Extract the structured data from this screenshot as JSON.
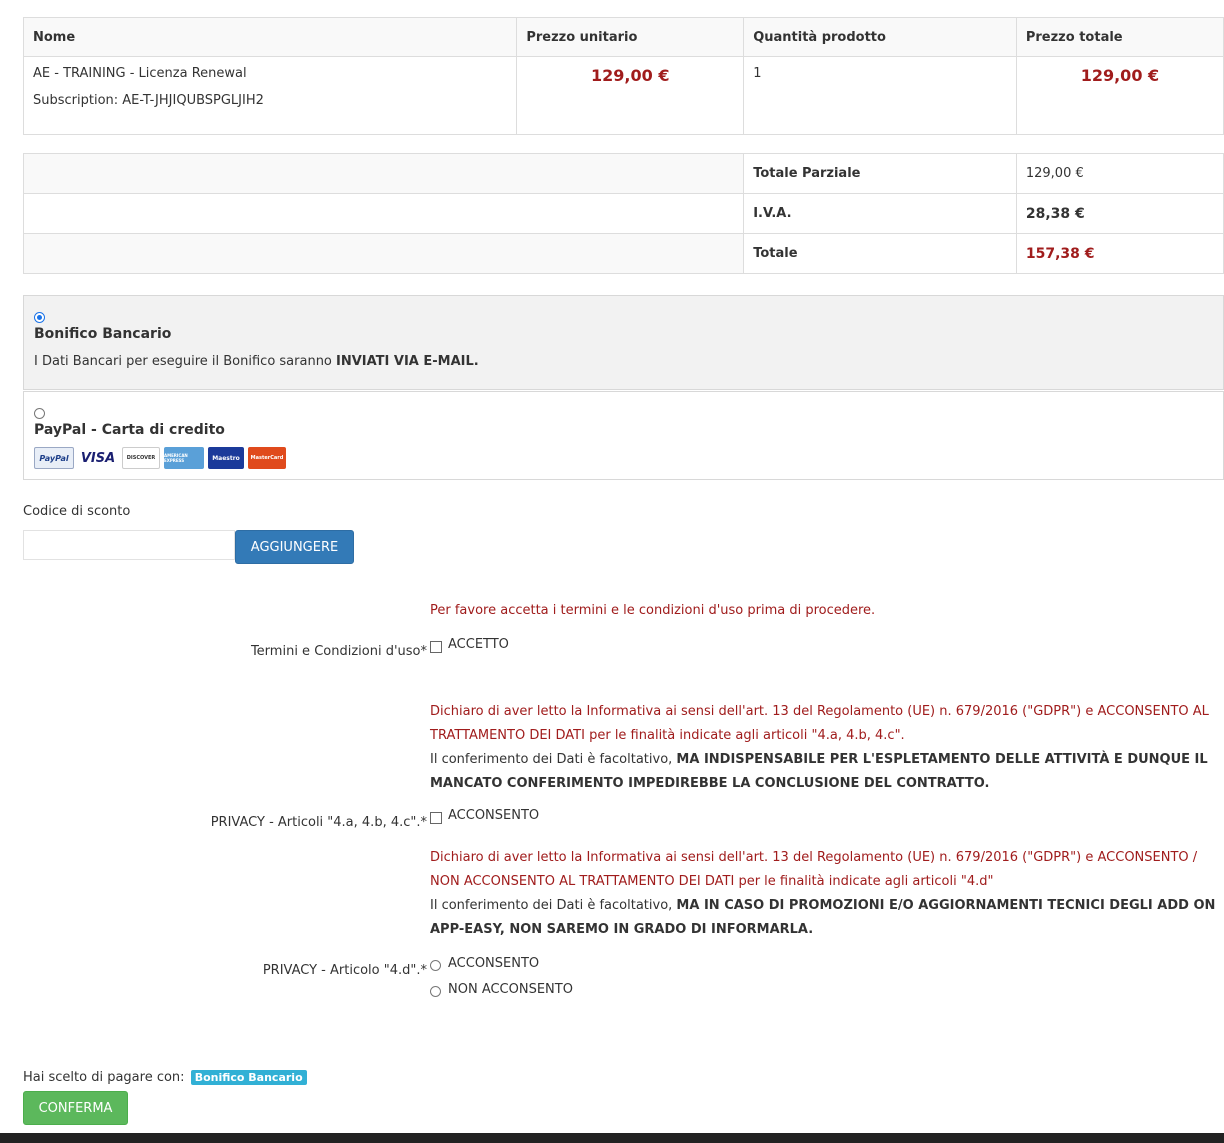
{
  "cart": {
    "headers": [
      "Nome",
      "Prezzo unitario",
      "Quantità prodotto",
      "Prezzo totale"
    ],
    "item": {
      "name": "AE - TRAINING - Licenza Renewal",
      "subscription": "Subscription: AE-T-JHJIQUBSPGLJIH2",
      "unit_price": "129,00 €",
      "quantity": "1",
      "total_price": "129,00 €"
    },
    "summary": [
      {
        "label": "Totale Parziale",
        "value": "129,00 €"
      },
      {
        "label": "I.V.A.",
        "value": "28,38 €"
      },
      {
        "label": "Totale",
        "value": "157,38 €"
      }
    ]
  },
  "payment": {
    "bank": {
      "title": "Bonifico Bancario",
      "desc_prefix": "I Dati Bancari per eseguire il Bonifico saranno ",
      "desc_bold": "INVIATI VIA E-MAIL.",
      "selected": true
    },
    "paypal": {
      "title": "PayPal - Carta di credito",
      "selected": false,
      "cards": [
        "PayPal",
        "VISA",
        "DISCOVER",
        "AMERICAN EXPRESS",
        "Maestro",
        "MasterCard"
      ]
    }
  },
  "discount": {
    "label": "Codice di sconto",
    "value": "",
    "button": "AGGIUNGERE"
  },
  "terms": {
    "warning": "Per favore accetta i termini e le condizioni d'uso prima di procedere.",
    "label": "Termini e Condizioni d'uso*",
    "option": "ACCETTO"
  },
  "privacy1": {
    "text_red": "Dichiaro di aver letto la Informativa ai sensi dell'art. 13 del Regolamento (UE) n. 679/2016 (\"GDPR\") e ACCONSENTO AL TRATTAMENTO DEI DATI per le finalità indicate agli articoli \"4.a, 4.b, 4.c\".",
    "text_normal": "Il conferimento dei Dati è facoltativo, ",
    "text_bold": "MA INDISPENSABILE PER L'ESPLETAMENTO DELLE ATTIVITÀ E DUNQUE IL MANCATO CONFERIMENTO IMPEDIREBBE LA CONCLUSIONE DEL CONTRATTO.",
    "label": "PRIVACY - Articoli \"4.a, 4.b, 4.c\".*",
    "option": "ACCONSENTO"
  },
  "privacy2": {
    "text_red": "Dichiaro di aver letto la Informativa ai sensi dell'art. 13 del Regolamento (UE) n. 679/2016 (\"GDPR\") e ACCONSENTO / NON ACCONSENTO AL TRATTAMENTO DEI DATI per le finalità indicate agli articoli \"4.d\"",
    "text_normal": "Il conferimento dei Dati è facoltativo, ",
    "text_bold": "MA IN CASO DI PROMOZIONI E/O AGGIORNAMENTI TECNICI DEGLI ADD ON APP-EASY, NON SAREMO IN GRADO DI INFORMARLA.",
    "label": "PRIVACY - Articolo \"4.d\".*",
    "option_yes": "ACCONSENTO",
    "option_no": "NON ACCONSENTO"
  },
  "confirm": {
    "chosen_prefix": "Hai scelto di pagare con:",
    "chosen_badge": "Bonifico Bancario",
    "button": "CONFERMA"
  },
  "colors": {
    "price_red": "#a01c1c",
    "button_blue": "#337ab7",
    "button_green": "#5cb85c",
    "badge": "#31b0d5"
  }
}
